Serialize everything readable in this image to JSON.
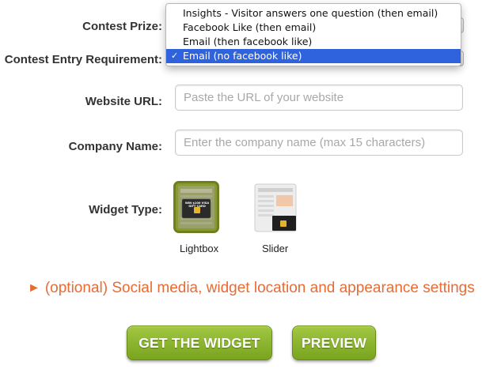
{
  "form": {
    "contest_prize_label": "Contest Prize:",
    "entry_requirement_label": "Contest Entry Requirement:",
    "website_url_label": "Website URL:",
    "website_url_placeholder": "Paste the URL of your website",
    "company_name_label": "Company Name:",
    "company_name_placeholder": "Enter the company name (max 15 characters)",
    "widget_type_label": "Widget Type:"
  },
  "entry_dropdown": {
    "selected": "Email (no facebook like)",
    "check": "✓",
    "options": [
      "Insights - Visitor answers one question (then email)",
      "Facebook Like (then email)",
      "Email (then facebook like)",
      "Email (no facebook like)"
    ]
  },
  "widget_types": {
    "selected": "Lightbox",
    "options": [
      {
        "label": "Lightbox",
        "icon": "lightbox-thumbnail-icon"
      },
      {
        "label": "Slider",
        "icon": "slider-thumbnail-icon"
      }
    ],
    "gift_card_text": "WIN $100 VISA GIFT CARD"
  },
  "optional_settings": {
    "arrow": "►",
    "text": "(optional) Social media, widget location and appearance settings"
  },
  "buttons": {
    "get_widget": "GET THE WIDGET",
    "preview": "PREVIEW"
  },
  "colors": {
    "accent_orange": "#e86b34",
    "button_green": "#8cb52f",
    "selection_blue": "#2f63dd",
    "selected_thumb_border": "#6e7f1f"
  }
}
